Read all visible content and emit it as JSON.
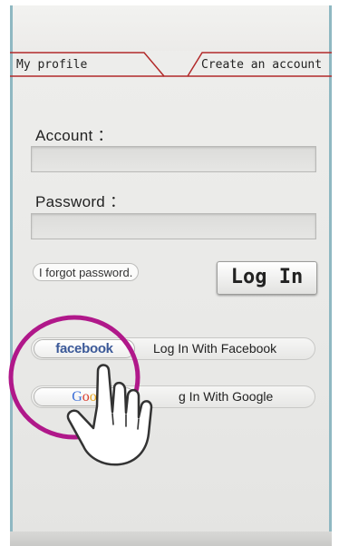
{
  "tabs": {
    "profile_label": "My profile",
    "create_label": "Create an account"
  },
  "form": {
    "account_label": "Account ：",
    "account_value": "",
    "password_label": "Password ：",
    "password_value": ""
  },
  "actions": {
    "forgot_label": "I forgot password.",
    "login_label": "Log In"
  },
  "social": {
    "facebook_logo": "facebook",
    "facebook_label": "Log In With Facebook",
    "google_logo": "Goo",
    "google_label": "g In With Google"
  },
  "colors": {
    "accent_tab_border": "#b22a2a",
    "highlight_circle": "#b0188a",
    "facebook_blue": "#3b5998",
    "frame_border": "#8fb8c2"
  },
  "icons": {
    "pointer": "pointing-hand-icon"
  }
}
